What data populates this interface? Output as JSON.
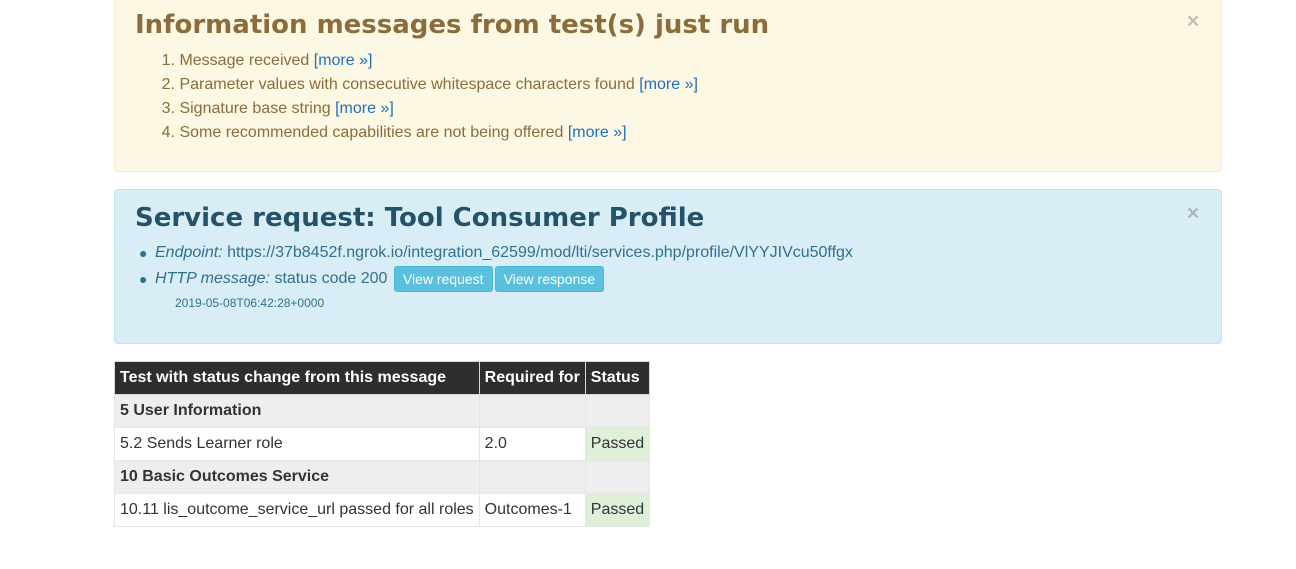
{
  "info_alert": {
    "title": "Information messages from test(s) just run",
    "close_label": "×",
    "items": [
      {
        "num": "1.",
        "text": "Message received",
        "more": "[more »]"
      },
      {
        "num": "2.",
        "text": "Parameter values with consecutive whitespace characters found",
        "more": "[more »]"
      },
      {
        "num": "3.",
        "text": "Signature base string",
        "more": "[more »]"
      },
      {
        "num": "4.",
        "text": "Some recommended capabilities are not being offered",
        "more": "[more »]"
      }
    ]
  },
  "service_alert": {
    "title": "Service request: Tool Consumer Profile",
    "close_label": "×",
    "endpoint_label": "Endpoint:",
    "endpoint_value": "https://37b8452f.ngrok.io/integration_62599/mod/lti/services.php/profile/VlYYJIVcu50ffgx",
    "http_label": "HTTP message:",
    "http_value": "status code 200",
    "view_request": "View request",
    "view_response": "View response",
    "timestamp": "2019-05-08T06:42:28+0000"
  },
  "results_table": {
    "headers": [
      "Test with status change from this message",
      "Required for",
      "Status"
    ],
    "rows": [
      {
        "type": "group",
        "label": "5  User Information"
      },
      {
        "type": "test",
        "test": "5.2  Sends Learner role",
        "required": "2.0",
        "status": "Passed"
      },
      {
        "type": "group",
        "label": "10  Basic Outcomes Service"
      },
      {
        "type": "test",
        "test": "10.11  lis_outcome_service_url passed for all roles",
        "required": "Outcomes-1",
        "status": "Passed"
      }
    ]
  },
  "colors": {
    "warning_bg": "#fcf8e3",
    "info_bg": "#d9edf7",
    "button": "#5bc0de",
    "passed_bg": "#dff0d8",
    "table_header": "#2e2e2e"
  }
}
